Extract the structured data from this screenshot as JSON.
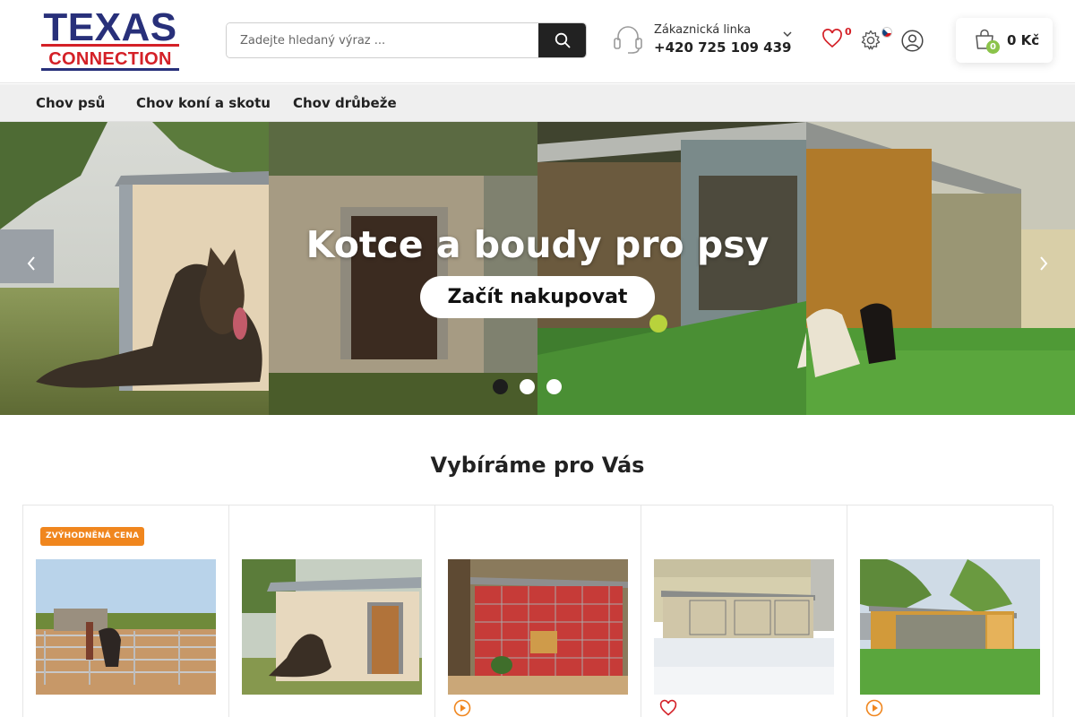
{
  "header": {
    "logo_line1": "TEXAS",
    "logo_line2": "CONNECTION",
    "search_placeholder": "Zadejte hledaný výraz ...",
    "support_label": "Zákaznická linka",
    "support_phone": "+420 725 109 439",
    "wishlist_count": "0",
    "cart_count": "0",
    "cart_total": "0 Kč"
  },
  "nav": {
    "items": [
      "Chov psů",
      "Chov koní a skotu",
      "Chov drůbeže"
    ]
  },
  "hero": {
    "title": "Kotce a boudy pro psy",
    "cta": "Začít nakupovat",
    "slides": 3,
    "active_slide": 1
  },
  "section": {
    "title": "Vybíráme pro Vás"
  },
  "products": [
    {
      "badge": "ZVÝHODNĚNÁ CENA",
      "image": "horse-round-pen-photo",
      "action_icon": "none"
    },
    {
      "badge": "",
      "image": "dog-kennel-with-shepherd-photo",
      "action_icon": "none"
    },
    {
      "badge": "",
      "image": "red-kennel-with-mesh-photo",
      "action_icon": "play-icon"
    },
    {
      "badge": "",
      "image": "kennels-in-snow-photo",
      "action_icon": "heart-icon"
    },
    {
      "badge": "",
      "image": "large-wooden-kennel-photo",
      "action_icon": "play-icon"
    }
  ],
  "colors": {
    "brand_blue": "#28307a",
    "brand_red": "#d42027",
    "badge_orange": "#f0861e",
    "cart_badge_green": "#8bc34a"
  }
}
